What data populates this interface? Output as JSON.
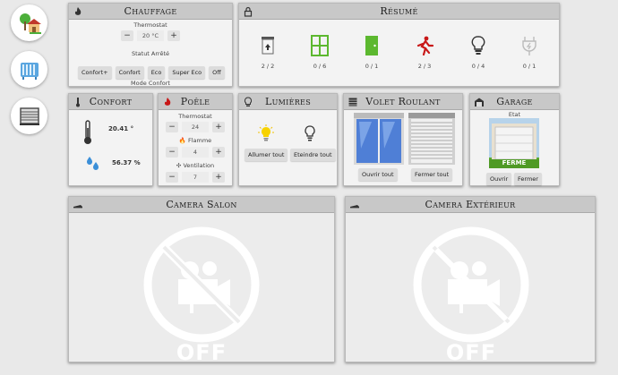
{
  "nav": [
    {
      "name": "home-icon"
    },
    {
      "name": "radiator-icon"
    },
    {
      "name": "shutter-icon"
    }
  ],
  "chauffage": {
    "title": "Chauffage",
    "thermostat_label": "Thermostat",
    "thermostat_value": "20 °C",
    "status": "Statut Arrêté",
    "modes": [
      "Confort+",
      "Confort",
      "Eco",
      "Super Eco",
      "Off"
    ],
    "mode_label": "Mode Confort"
  },
  "resume": {
    "title": "Résumé",
    "items": [
      {
        "icon": "shutter-up-icon",
        "value": "2 / 2"
      },
      {
        "icon": "window-icon",
        "value": "0 / 6"
      },
      {
        "icon": "door-icon",
        "value": "0 / 1"
      },
      {
        "icon": "motion-icon",
        "value": "2 / 3"
      },
      {
        "icon": "bulb-icon",
        "value": "0 / 4"
      },
      {
        "icon": "plug-icon",
        "value": "0 / 1"
      }
    ]
  },
  "confort": {
    "title": "Confort",
    "temperature": "20.41 °",
    "humidity": "56.37 %"
  },
  "poele": {
    "title": "Poêle",
    "thermostat_label": "Thermostat",
    "thermostat_value": "24",
    "flamme_label": "Flamme",
    "flamme_value": "4",
    "ventilation_label": "Ventilation",
    "ventilation_value": "7"
  },
  "lumieres": {
    "title": "Lumières",
    "on_label": "Allumer tout",
    "off_label": "Eteindre tout"
  },
  "volet": {
    "title": "Volet Roulant",
    "open_label": "Ouvrir tout",
    "close_label": "Fermer tout"
  },
  "garage": {
    "title": "Garage",
    "state_label": "Etat",
    "state_value": "FERME",
    "open_label": "Ouvrir",
    "close_label": "Fermer"
  },
  "camera_salon": {
    "title": "Camera Salon",
    "status": "OFF"
  },
  "camera_exterieur": {
    "title": "Camera Extérieur",
    "status": "OFF"
  },
  "colors": {
    "green": "#5cb82f",
    "red": "#c81818",
    "header": "#c8c8c8"
  }
}
